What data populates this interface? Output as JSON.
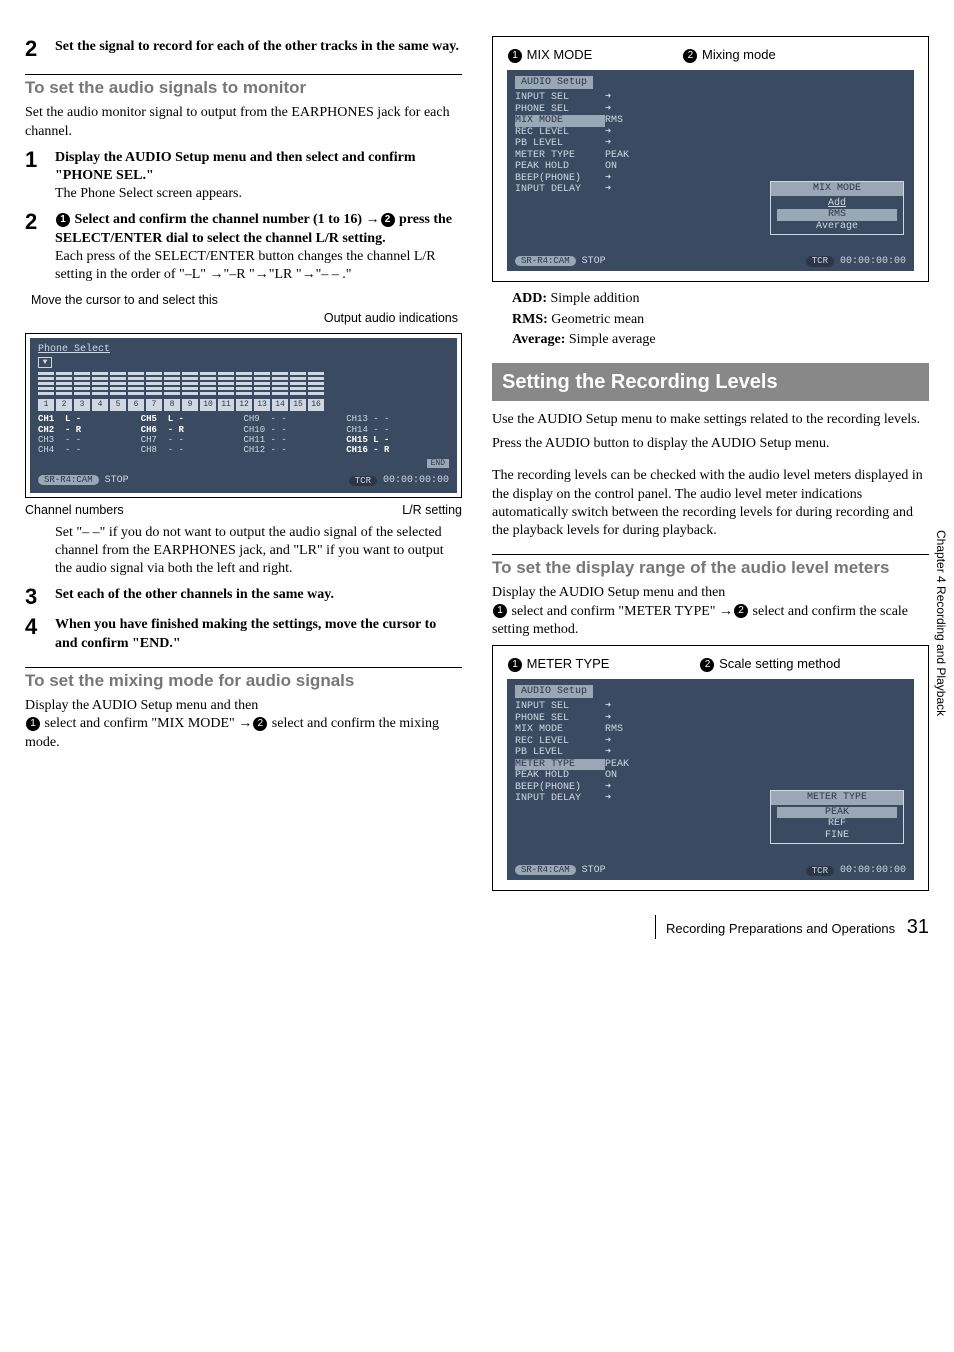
{
  "left": {
    "step2": "Set the signal to record for each of the other tracks in the same way.",
    "sub1": "To set the audio signals to monitor",
    "sub1_text": "Set the audio monitor signal to output from the EARPHONES jack for each channel.",
    "m_step1": "Display the AUDIO Setup menu and then select and confirm \"PHONE SEL.\"",
    "m_step1_after": "The Phone Select screen appears.",
    "m_step2_a": " Select and confirm the channel number (1 to 16) →",
    "m_step2_b": " press the SELECT/ENTER dial to select the channel L/R setting.",
    "m_step2_after": "Each press of the SELECT/ENTER button changes the channel L/R setting in the order of \"–L\" →\"–R \"→\"LR \"→\"– – .\"",
    "chart_topnote": "Move the cursor to and select this",
    "chart_caption": "Output audio indications",
    "annot_left": "Channel numbers",
    "annot_right": "L/R setting",
    "ps_explain": "Set \"– –\" if you do not want to output the audio signal of the selected channel from the EARPHONES jack, and \"LR\" if you want to output the audio signal via both the left and right.",
    "m_step3": "Set each of the other channels in the same way.",
    "m_step4": "When you have finished making the settings, move the cursor to and confirm \"END.\"",
    "sub2": "To set the mixing mode for audio signals",
    "sub2_text_a": "Display the AUDIO Setup menu and then ",
    "sub2_text_b": " select and confirm \"MIX MODE\" →",
    "sub2_text_c": " select and confirm the mixing mode."
  },
  "right": {
    "mix_label1": "MIX MODE",
    "mix_label2": "Mixing mode",
    "mix_menu": {
      "title": "AUDIO Setup",
      "items": [
        {
          "label": "INPUT SEL",
          "val": "arrow"
        },
        {
          "label": "PHONE SEL",
          "val": "arrow"
        },
        {
          "label": "MIX MODE",
          "val": "RMS",
          "hi": true
        },
        {
          "label": "REC LEVEL",
          "val": "arrow"
        },
        {
          "label": "PB LEVEL",
          "val": "arrow"
        },
        {
          "label": "METER TYPE",
          "val": "PEAK"
        },
        {
          "label": "PEAK HOLD",
          "val": "ON"
        },
        {
          "label": "BEEP(PHONE)",
          "val": "arrow"
        },
        {
          "label": "INPUT DELAY",
          "val": "arrow"
        }
      ],
      "popup_title": "MIX MODE",
      "popup_opts": [
        "Add",
        "RMS",
        "Average"
      ],
      "popup_selected": "RMS",
      "foot_left": "SR-R4:CAM",
      "foot_stop": "STOP",
      "foot_tcr": "TCR",
      "foot_time": "00:00:00:00"
    },
    "defs": [
      {
        "k": "ADD:",
        "v": " Simple addition"
      },
      {
        "k": "RMS:",
        "v": " Geometric mean"
      },
      {
        "k": "Average:",
        "v": " Simple average"
      }
    ],
    "banner": "Setting the Recording Levels",
    "para1": "Use the AUDIO Setup menu to make settings related to the recording levels.",
    "para2": "Press the AUDIO button to display the AUDIO Setup menu.",
    "para3": "The recording levels can be checked with the audio level meters displayed in the display on the control panel. The audio level meter indications automatically switch between the recording levels for during recording and the playback levels for during playback.",
    "sub3": "To set the display range of the audio level meters",
    "sub3_a": "Display the AUDIO Setup menu and then ",
    "sub3_b": " select and confirm \"METER TYPE\" →",
    "sub3_c": " select and confirm the scale setting method.",
    "meter_label1": "METER TYPE",
    "meter_label2": "Scale setting method",
    "meter_menu": {
      "title": "AUDIO Setup",
      "items": [
        {
          "label": "INPUT SEL",
          "val": "arrow"
        },
        {
          "label": "PHONE SEL",
          "val": "arrow"
        },
        {
          "label": "MIX MODE",
          "val": "RMS"
        },
        {
          "label": "REC LEVEL",
          "val": "arrow"
        },
        {
          "label": "PB LEVEL",
          "val": "arrow"
        },
        {
          "label": "METER TYPE",
          "val": "PEAK",
          "hi": true
        },
        {
          "label": "PEAK HOLD",
          "val": "ON"
        },
        {
          "label": "BEEP(PHONE)",
          "val": "arrow"
        },
        {
          "label": "INPUT DELAY",
          "val": "arrow"
        }
      ],
      "popup_title": "METER TYPE",
      "popup_opts": [
        "PEAK",
        "REF",
        "FINE"
      ],
      "popup_selected": "PEAK",
      "foot_left": "SR-R4:CAM",
      "foot_stop": "STOP",
      "foot_tcr": "TCR",
      "foot_time": "00:00:00:00"
    }
  },
  "phone_select": {
    "title": "Phone Select",
    "channels": [
      {
        "n": "CH1",
        "v": "L -",
        "bold": true
      },
      {
        "n": "CH5",
        "v": "L -",
        "bold": true
      },
      {
        "n": "CH9",
        "v": "- -"
      },
      {
        "n": "CH13",
        "v": "- -"
      },
      {
        "n": "CH2",
        "v": "- R",
        "bold": true
      },
      {
        "n": "CH6",
        "v": "- R",
        "bold": true
      },
      {
        "n": "CH10",
        "v": "- -"
      },
      {
        "n": "CH14",
        "v": "- -"
      },
      {
        "n": "CH3",
        "v": "- -"
      },
      {
        "n": "CH7",
        "v": "- -"
      },
      {
        "n": "CH11",
        "v": "- -"
      },
      {
        "n": "CH15",
        "v": "L -",
        "bold": true
      },
      {
        "n": "CH4",
        "v": "- -"
      },
      {
        "n": "CH8",
        "v": "- -"
      },
      {
        "n": "CH12",
        "v": "- -"
      },
      {
        "n": "CH16",
        "v": "- R",
        "bold": true
      }
    ],
    "end": "END",
    "foot_left": "SR-R4:CAM",
    "foot_stop": "STOP",
    "foot_tcr": "TCR",
    "foot_time": "00:00:00:00"
  },
  "sidebar": "Chapter 4  Recording and Playback",
  "footer_text": "Recording Preparations and Operations",
  "page_number": "31"
}
